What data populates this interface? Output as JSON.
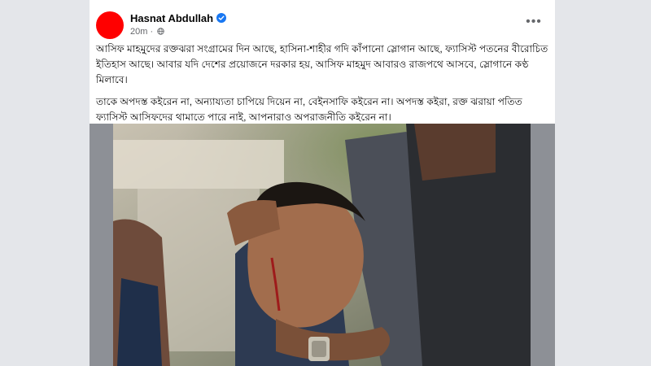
{
  "post": {
    "author": "Hasnat Abdullah",
    "time": "20m",
    "more_label": "•••",
    "paragraphs": [
      "আসিফ মাহমুদের রক্তঝরা সংগ্রামের দিন আছে, হাসিনা-শাহীর গদি কাঁপানো স্লোগান আছে, ফ্যাসিস্ট পতনের বীরোচিত ইতিহাস আছে। আবার যদি দেশের প্রয়োজনে দরকার হয়, আসিফ মাহমুদ আবারও রাজপথে আসবে, স্লোগানে কণ্ঠ মিলাবে।",
      "তাকে অপদস্ত কইরেন না, অন্যায্যতা চাপিয়ে দিয়েন না, বেইনসাফি কইরেন না। অপদস্ত কইরা, রক্ত ঝরায়া পতিত ফ্যাসিস্ট আসিফদের থামাতে পারে নাই, আপনারাও অপরাজনীতি কইরেন না।"
    ]
  },
  "colors": {
    "avatar": "#ff0000",
    "verified": "#1877f2",
    "page_background": "#e4e6ea",
    "media_letterbox": "#8d9096"
  },
  "icons": {
    "verified": "verified-badge-icon",
    "audience": "globe-icon",
    "more": "more-options-icon"
  }
}
